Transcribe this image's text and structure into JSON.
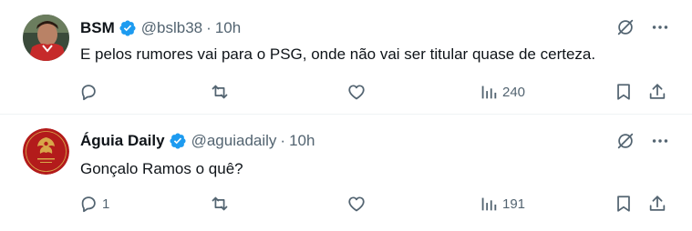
{
  "tweets": [
    {
      "name": "BSM",
      "handle": "@bslb38",
      "dot": "·",
      "time": "10h",
      "text": "E pelos rumores vai para o PSG, onde não vai ser titular quase de certeza.",
      "reply_count": "",
      "views": "240",
      "avatar": "player-photo-red-shirt"
    },
    {
      "name": "Águia Daily",
      "handle": "@aguiadaily",
      "dot": "·",
      "time": "10h",
      "text": "Gonçalo Ramos o quê?",
      "reply_count": "1",
      "views": "191",
      "avatar": "eagle-logo-red-circle"
    }
  ],
  "icons": {
    "verified": "verified-badge-icon",
    "grok": "grok-icon",
    "more": "more-icon",
    "reply": "reply-icon",
    "retweet": "retweet-icon",
    "like": "like-icon",
    "views": "views-icon",
    "bookmark": "bookmark-icon",
    "share": "share-icon"
  },
  "colors": {
    "verified": "#1d9bf0",
    "icon_gray": "#536471",
    "text": "#0f1419",
    "avatar_red": "#b31b1b",
    "avatar_gold": "#d8a74a"
  }
}
